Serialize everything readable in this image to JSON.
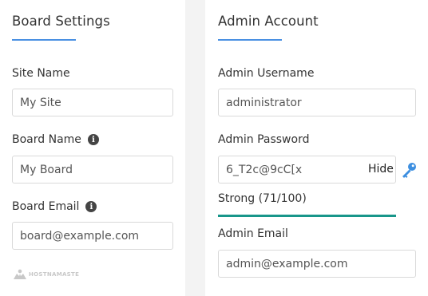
{
  "board_settings": {
    "title": "Board Settings",
    "site_name_label": "Site Name",
    "site_name_value": "My Site",
    "board_name_label": "Board Name",
    "board_name_value": "My Board",
    "board_email_label": "Board Email",
    "board_email_value": "board@example.com",
    "logo_text": "HOSTNAMASTE",
    "accent_color": "#4a90e2"
  },
  "admin_account": {
    "title": "Admin Account",
    "username_label": "Admin Username",
    "username_value": "administrator",
    "password_label": "Admin Password",
    "password_value": "6_T2c@9cC[x",
    "hide_label": "Hide",
    "strength_text": "Strong (71/100)",
    "strength_percent": 71,
    "strength_color": "#18968a",
    "email_label": "Admin Email",
    "email_value": "admin@example.com"
  },
  "icons": {
    "info": "info-icon",
    "key": "key-icon"
  }
}
